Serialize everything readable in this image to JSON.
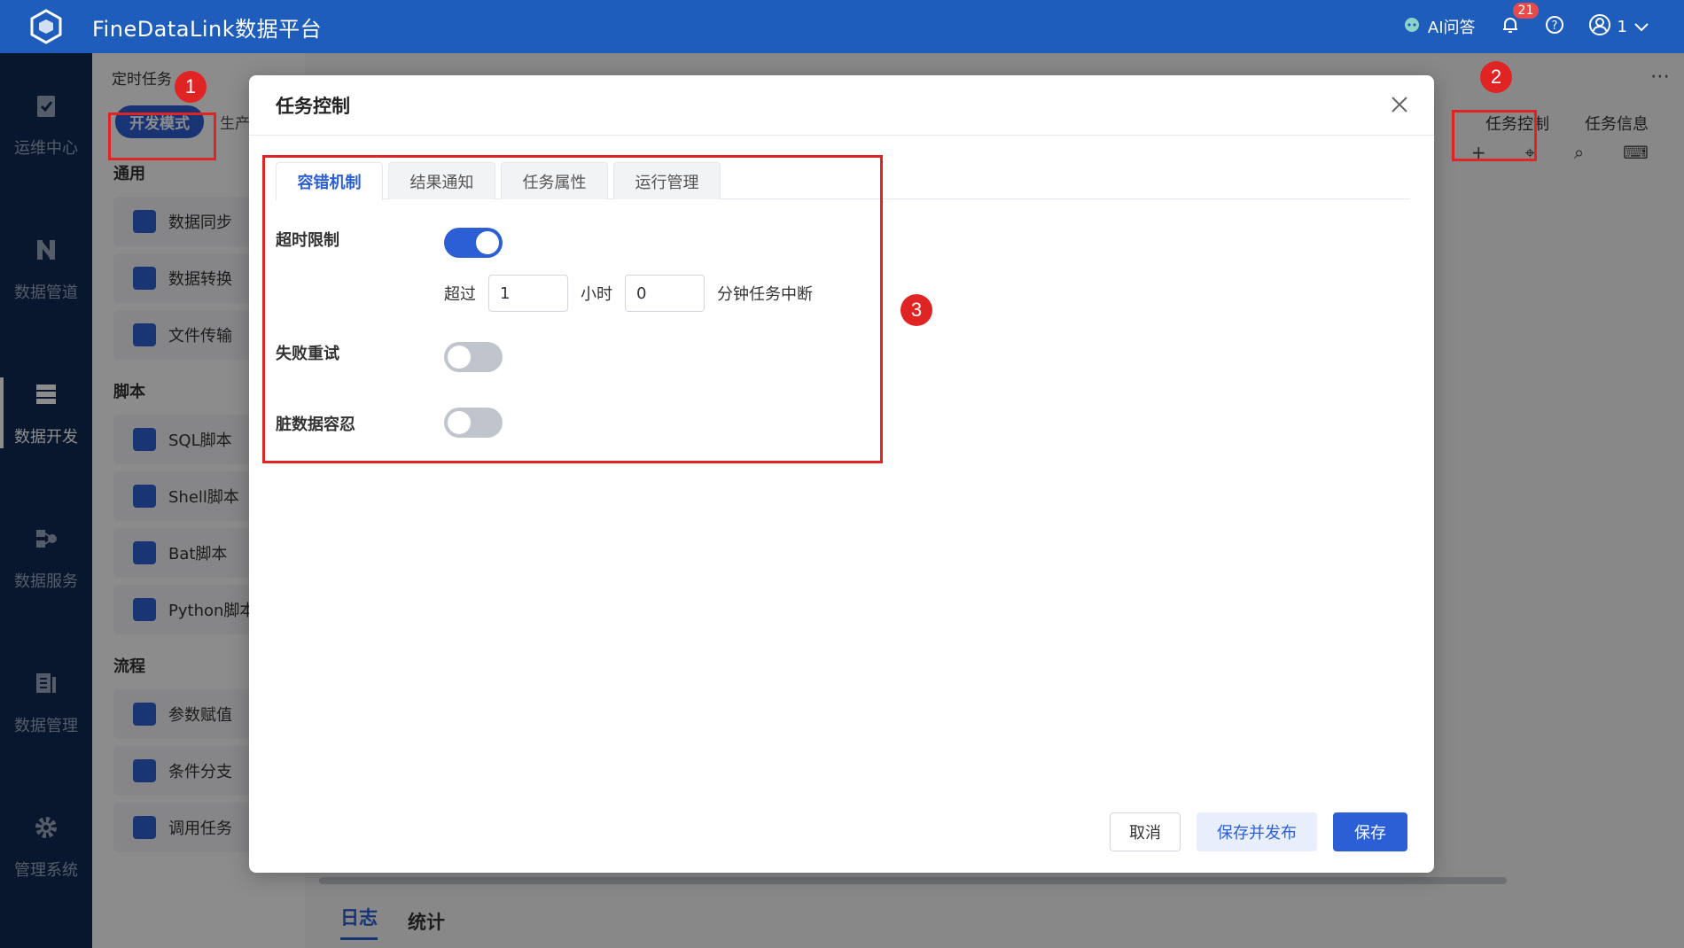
{
  "header": {
    "app_title": "FineDataLink数据平台",
    "ai_label": "AI问答",
    "notification_count": "21",
    "user_name": "1"
  },
  "left_nav": {
    "items": [
      {
        "label": "运维中心",
        "icon": "clipboard-check-icon"
      },
      {
        "label": "数据管道",
        "icon": "pipeline-icon"
      },
      {
        "label": "数据开发",
        "icon": "database-stack-icon",
        "active": true
      },
      {
        "label": "数据服务",
        "icon": "service-icon"
      },
      {
        "label": "数据管理",
        "icon": "data-manage-icon"
      },
      {
        "label": "管理系统",
        "icon": "gear-icon"
      }
    ]
  },
  "secondary": {
    "tab_label": "定时任务",
    "mode_active": "开发模式",
    "mode_other": "生产",
    "groups": [
      {
        "title": "通用",
        "items": [
          "数据同步",
          "数据转换",
          "文件传输"
        ]
      },
      {
        "title": "脚本",
        "items": [
          "SQL脚本",
          "Shell脚本",
          "Bat脚本",
          "Python脚本"
        ]
      },
      {
        "title": "流程",
        "items": [
          "参数赋值",
          "条件分支",
          "调用任务"
        ]
      }
    ]
  },
  "canvas": {
    "task_control": "任务控制",
    "task_info": "任务信息",
    "bottom_tabs": [
      "日志",
      "统计"
    ]
  },
  "modal": {
    "title": "任务控制",
    "tabs": [
      "容错机制",
      "结果通知",
      "任务属性",
      "运行管理"
    ],
    "active_tab": 0,
    "timeout": {
      "label": "超时限制",
      "enabled": true,
      "prefix": "超过",
      "hours_value": "1",
      "hours_unit": "小时",
      "minutes_value": "0",
      "suffix": "分钟任务中断"
    },
    "retry": {
      "label": "失败重试",
      "enabled": false
    },
    "dirty_data": {
      "label": "脏数据容忍",
      "enabled": false
    },
    "buttons": {
      "cancel": "取消",
      "save_publish": "保存并发布",
      "save": "保存"
    }
  },
  "annotations": {
    "marker_1": "1",
    "marker_2": "2",
    "marker_3": "3"
  },
  "colors": {
    "primary": "#2c5fd6",
    "header_bg": "#1f5dbd",
    "nav_bg": "#0f2a52",
    "annotation_red": "#e02424"
  }
}
